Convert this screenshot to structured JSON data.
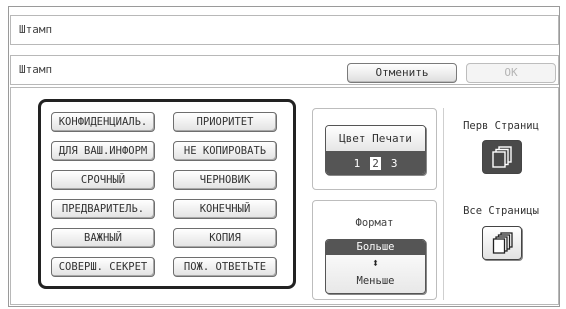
{
  "title": "Штамп",
  "header": {
    "label": "Штамп",
    "cancel_label": "Отменить",
    "ok_label": "OK"
  },
  "stamps": {
    "left": [
      "КОНФИДЕНЦИАЛЬ.",
      "ДЛЯ ВАШ.ИНФОРМ",
      "СРОЧНЫЙ",
      "ПРЕДВАРИТЕЛЬ.",
      "ВАЖНЫЙ",
      "СОВЕРШ. СЕКРЕТ"
    ],
    "right": [
      "ПРИОРИТЕТ",
      "НЕ КОПИРОВАТЬ",
      "ЧЕРНОВИК",
      "КОНЕЧНЫЙ",
      "КОПИЯ",
      "ПОЖ. ОТВЕТЬТЕ"
    ]
  },
  "print_color": {
    "label": "Цвет Печати",
    "options": [
      "1",
      "2",
      "3"
    ],
    "selected": "2"
  },
  "format": {
    "label": "Формат",
    "more": "Больше",
    "less": "Меньше",
    "selected": "Больше"
  },
  "pages": {
    "first_label": "Перв Страниц",
    "all_label": "Все Страницы",
    "selected": "first"
  },
  "icons": {
    "first_page": "pages-stack-icon",
    "all_pages": "pages-stack-icon",
    "format_arrows": "up-down-arrows-icon"
  },
  "colors": {
    "selected_bg": "#555555",
    "dark_button": "#4a4a4a"
  }
}
